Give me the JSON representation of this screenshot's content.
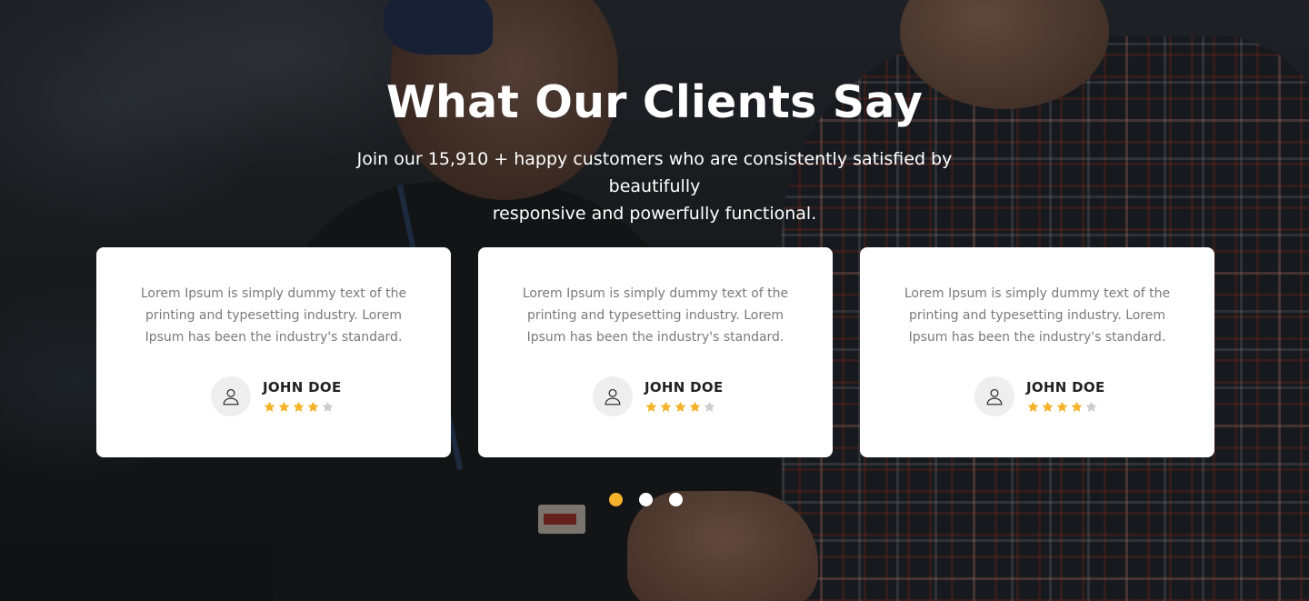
{
  "section": {
    "title": "What Our Clients Say",
    "subtitle_line1": "Join our 15,910 + happy customers who are consistently satisfied by beautifully",
    "subtitle_line2": "responsive and powerfully functional."
  },
  "testimonials": [
    {
      "text_line1": "Lorem Ipsum is simply dummy text of the",
      "text_line2": "printing and typesetting industry. Lorem",
      "text_line3": "Ipsum has been the industry's standard.",
      "name": "JOHN DOE",
      "rating": 4,
      "rating_max": 5,
      "avatar_icon": "user-icon"
    },
    {
      "text_line1": "Lorem Ipsum is simply dummy text of the",
      "text_line2": "printing and typesetting industry. Lorem",
      "text_line3": "Ipsum has been the industry's standard.",
      "name": "JOHN DOE",
      "rating": 4,
      "rating_max": 5,
      "avatar_icon": "user-icon"
    },
    {
      "text_line1": "Lorem Ipsum is simply dummy text of the",
      "text_line2": "printing and typesetting industry. Lorem",
      "text_line3": "Ipsum has been the industry's standard.",
      "name": "JOHN DOE",
      "rating": 4,
      "rating_max": 5,
      "avatar_icon": "user-icon"
    }
  ],
  "pagination": {
    "count": 3,
    "active_index": 0
  },
  "colors": {
    "accent": "#f5b32c",
    "star_filled": "#f5b32c",
    "star_empty": "#cccccc",
    "card_bg": "#ffffff",
    "dot_inactive": "#ffffff"
  }
}
